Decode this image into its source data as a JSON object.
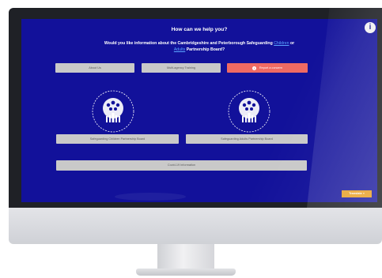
{
  "page": {
    "title": "How can we help you?",
    "subtitle_before": "Would you like information about the Cambridgeshire and Peterborough Safeguarding ",
    "subtitle_link_children": "Children",
    "subtitle_middle": " or ",
    "subtitle_link_adults": "Adults",
    "subtitle_after": " Partnership Board?"
  },
  "buttons": {
    "about_us": "About Us",
    "multi_agency_training": "Multi-agency Training",
    "report_concern": "Report a concern",
    "children_board": "Safeguarding Children Partnership Board",
    "adults_board": "Safeguarding Adults Partnership Board",
    "covid": "Covid-19 Information",
    "translate": "Translate »"
  },
  "colors": {
    "screen_background": "#12119a",
    "button_grey": "#c9c9c9",
    "report_red": "#ef6a63",
    "translate_orange": "#e8a12a",
    "link_blue": "#5aa3ff"
  },
  "icons": {
    "corner": "info-icon",
    "report": "exclamation-icon",
    "logo_left": "tree-logo-children",
    "logo_right": "tree-logo-adults"
  }
}
